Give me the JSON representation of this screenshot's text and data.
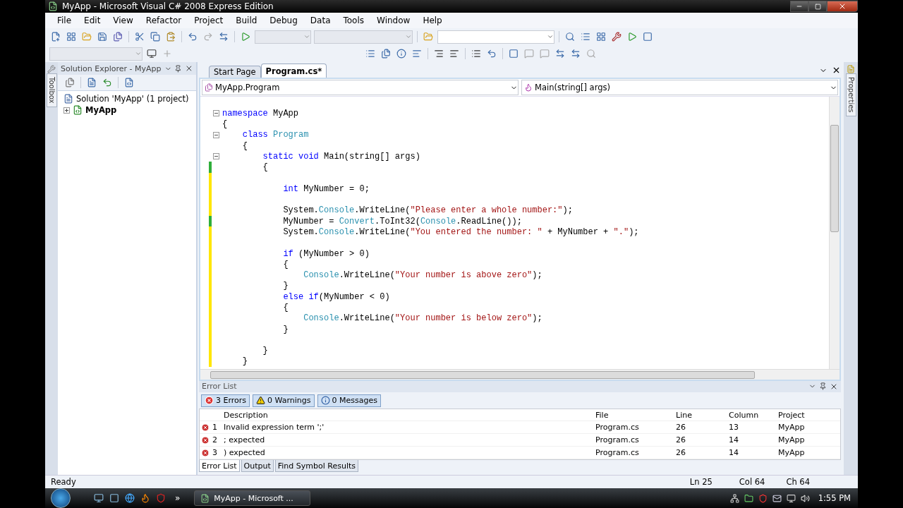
{
  "window": {
    "title": "MyApp - Microsoft Visual C# 2008 Express Edition"
  },
  "menu": [
    "File",
    "Edit",
    "View",
    "Refactor",
    "Project",
    "Build",
    "Debug",
    "Data",
    "Tools",
    "Window",
    "Help"
  ],
  "side_tabs": {
    "left": "Toolbox",
    "right": "Properties"
  },
  "solution_explorer": {
    "title": "Solution Explorer - MyApp",
    "tree": [
      {
        "label": "Solution 'MyApp' (1 project)",
        "startup": false,
        "children": [
          {
            "label": "MyApp",
            "startup": true,
            "expanded": false
          }
        ]
      }
    ]
  },
  "editor": {
    "tabs": [
      {
        "label": "Start Page",
        "selected": false
      },
      {
        "label": "Program.cs*",
        "selected": true
      }
    ],
    "type_dropdown": "MyApp.Program",
    "member_dropdown": "Main(string[] args)",
    "lines": [
      {
        "fold": true,
        "modified": false,
        "tokens": [
          {
            "kind": "keyword",
            "text": "namespace"
          },
          {
            "kind": "plain",
            "text": " MyApp"
          }
        ]
      },
      {
        "fold": false,
        "modified": false,
        "tokens": [
          {
            "kind": "plain",
            "text": "{"
          }
        ]
      },
      {
        "fold": true,
        "modified": false,
        "tokens": [
          {
            "kind": "keyword",
            "text": "    class "
          },
          {
            "kind": "type",
            "text": "Program"
          }
        ]
      },
      {
        "fold": false,
        "modified": false,
        "tokens": [
          {
            "kind": "plain",
            "text": "    {"
          }
        ]
      },
      {
        "fold": true,
        "modified": false,
        "tokens": [
          {
            "kind": "keyword",
            "text": "        static void"
          },
          {
            "kind": "plain",
            "text": " Main(string[] args)"
          }
        ]
      },
      {
        "fold": false,
        "modified": true,
        "saved": true,
        "tokens": [
          {
            "kind": "plain",
            "text": "        {"
          }
        ]
      },
      {
        "fold": false,
        "modified": true,
        "saved": false
      },
      {
        "fold": false,
        "modified": true,
        "saved": false,
        "tokens": [
          {
            "kind": "keyword",
            "text": "            int"
          },
          {
            "kind": "plain",
            "text": " MyNumber = 0;"
          }
        ]
      },
      {
        "fold": false,
        "modified": true,
        "saved": false
      },
      {
        "fold": false,
        "modified": true,
        "saved": false,
        "tokens": [
          {
            "kind": "plain",
            "text": "            System."
          },
          {
            "kind": "type",
            "text": "Console"
          },
          {
            "kind": "plain",
            "text": ".WriteLine("
          },
          {
            "kind": "string",
            "text": "\"Please enter a whole number:\""
          },
          {
            "kind": "plain",
            "text": ");"
          }
        ]
      },
      {
        "fold": false,
        "modified": true,
        "saved": true,
        "tokens": [
          {
            "kind": "plain",
            "text": "            MyNumber = "
          },
          {
            "kind": "type",
            "text": "Convert"
          },
          {
            "kind": "plain",
            "text": ".ToInt32("
          },
          {
            "kind": "type",
            "text": "Console"
          },
          {
            "kind": "plain",
            "text": ".ReadLine());"
          }
        ]
      },
      {
        "fold": false,
        "modified": true,
        "saved": false,
        "tokens": [
          {
            "kind": "plain",
            "text": "            System."
          },
          {
            "kind": "type",
            "text": "Console"
          },
          {
            "kind": "plain",
            "text": ".WriteLine("
          },
          {
            "kind": "string",
            "text": "\"You entered the number: \""
          },
          {
            "kind": "plain",
            "text": " + MyNumber + "
          },
          {
            "kind": "string",
            "text": "\".\""
          },
          {
            "kind": "plain",
            "text": ");"
          }
        ]
      },
      {
        "fold": false,
        "modified": true,
        "saved": false
      },
      {
        "fold": false,
        "modified": true,
        "saved": false,
        "tokens": [
          {
            "kind": "keyword",
            "text": "            if"
          },
          {
            "kind": "plain",
            "text": " (MyNumber > 0)"
          }
        ]
      },
      {
        "fold": false,
        "modified": true,
        "saved": false,
        "tokens": [
          {
            "kind": "plain",
            "text": "            {"
          }
        ]
      },
      {
        "fold": false,
        "modified": true,
        "saved": false,
        "tokens": [
          {
            "kind": "type",
            "text": "                Console"
          },
          {
            "kind": "plain",
            "text": ".WriteLine("
          },
          {
            "kind": "string",
            "text": "\"Your number is above zero\""
          },
          {
            "kind": "plain",
            "text": ");"
          }
        ]
      },
      {
        "fold": false,
        "modified": true,
        "saved": false,
        "tokens": [
          {
            "kind": "plain",
            "text": "            }"
          }
        ]
      },
      {
        "fold": false,
        "modified": true,
        "saved": false,
        "tokens": [
          {
            "kind": "keyword",
            "text": "            else if"
          },
          {
            "kind": "plain",
            "text": "(MyNumber < 0)"
          }
        ]
      },
      {
        "fold": false,
        "modified": true,
        "saved": false,
        "tokens": [
          {
            "kind": "plain",
            "text": "            {"
          }
        ]
      },
      {
        "fold": false,
        "modified": true,
        "saved": false,
        "tokens": [
          {
            "kind": "type",
            "text": "                Console"
          },
          {
            "kind": "plain",
            "text": ".WriteLine("
          },
          {
            "kind": "string",
            "text": "\"Your number is below zero\""
          },
          {
            "kind": "plain",
            "text": ");"
          }
        ]
      },
      {
        "fold": false,
        "modified": true,
        "saved": false,
        "tokens": [
          {
            "kind": "plain",
            "text": "            }"
          }
        ]
      },
      {
        "fold": false,
        "modified": true,
        "saved": false
      },
      {
        "fold": false,
        "modified": true,
        "saved": false,
        "tokens": [
          {
            "kind": "plain",
            "text": "        }"
          }
        ]
      },
      {
        "fold": false,
        "modified": true,
        "saved": false,
        "tokens": [
          {
            "kind": "plain",
            "text": "    }"
          }
        ]
      }
    ]
  },
  "error_list": {
    "title": "Error List",
    "filters": [
      {
        "kind": "error",
        "label": "3 Errors",
        "selected": true
      },
      {
        "kind": "warning",
        "label": "0 Warnings",
        "selected": true
      },
      {
        "kind": "message",
        "label": "0 Messages",
        "selected": true
      }
    ],
    "columns": [
      "Description",
      "File",
      "Line",
      "Column",
      "Project"
    ],
    "rows": [
      {
        "number": "1",
        "description": "Invalid expression term ';'",
        "file": "Program.cs",
        "line": "26",
        "column": "13",
        "project": "MyApp"
      },
      {
        "number": "2",
        "description": "; expected",
        "file": "Program.cs",
        "line": "26",
        "column": "14",
        "project": "MyApp"
      },
      {
        "number": "3",
        "description": ") expected",
        "file": "Program.cs",
        "line": "26",
        "column": "14",
        "project": "MyApp"
      }
    ],
    "tabs": [
      {
        "label": "Error List",
        "selected": true
      },
      {
        "label": "Output",
        "selected": false
      },
      {
        "label": "Find Symbol Results",
        "selected": false
      }
    ]
  },
  "status_bar": {
    "text": "Ready",
    "ln": "Ln 25",
    "col": "Col 64",
    "ch": "Ch 64"
  },
  "taskbar": {
    "overflow": "»",
    "tasks": [
      {
        "label": "MyApp - Microsoft ...",
        "selected": true
      }
    ],
    "clock": "1:55 PM"
  }
}
